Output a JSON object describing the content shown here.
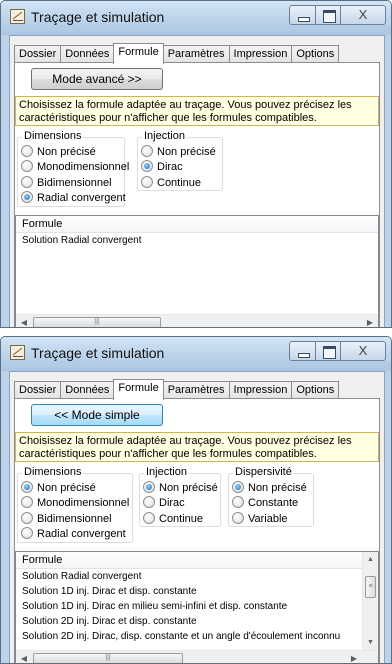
{
  "windows": [
    {
      "title": "Traçage et simulation",
      "tabs": [
        "Dossier",
        "Données",
        "Formule",
        "Paramètres",
        "Impression",
        "Options"
      ],
      "active_tab": 2,
      "mode_button": "Mode avancé >>",
      "info": "Choisissez la formule adaptée au traçage. Vous pouvez précisez les caractéristiques pour n'afficher que les formules compatibles.",
      "dimensions": {
        "label": "Dimensions",
        "options": [
          "Non précisé",
          "Monodimensionnel",
          "Bidimensionnel",
          "Radial convergent"
        ],
        "selected": 3
      },
      "injection": {
        "label": "Injection",
        "options": [
          "Non précisé",
          "Dirac",
          "Continue"
        ],
        "selected": 1
      },
      "formula_list": {
        "header": "Formule",
        "items": [
          "Solution Radial convergent"
        ]
      }
    },
    {
      "title": "Traçage et simulation",
      "tabs": [
        "Dossier",
        "Données",
        "Formule",
        "Paramètres",
        "Impression",
        "Options"
      ],
      "active_tab": 2,
      "mode_button": "<< Mode simple",
      "info": "Choisissez la formule adaptée au traçage. Vous pouvez précisez les caractéristiques pour n'afficher que les formules compatibles.",
      "dimensions": {
        "label": "Dimensions",
        "options": [
          "Non précisé",
          "Monodimensionnel",
          "Bidimensionnel",
          "Radial convergent"
        ],
        "selected": 0
      },
      "injection": {
        "label": "Injection",
        "options": [
          "Non précisé",
          "Dirac",
          "Continue"
        ],
        "selected": 0
      },
      "dispersivity": {
        "label": "Dispersivité",
        "options": [
          "Non précisé",
          "Constante",
          "Variable"
        ],
        "selected": 0
      },
      "formula_list": {
        "header": "Formule",
        "items": [
          "Solution Radial convergent",
          "Solution 1D inj. Dirac et disp. constante",
          "Solution 1D inj. Dirac en milieu semi-infini et disp. constante",
          "Solution 2D inj. Dirac et disp. constante",
          "Solution 2D inj. Dirac, disp. constante et un angle d'écoulement inconnu"
        ]
      }
    }
  ],
  "icons": {
    "app": "tracer-app-icon",
    "minimize": "minimize-icon",
    "maximize": "maximize-icon",
    "close": "close-icon",
    "scroll_left": "arrow-left-icon",
    "scroll_right": "arrow-right-icon",
    "scroll_up": "arrow-up-icon",
    "scroll_down": "arrow-down-icon"
  },
  "glyphs": {
    "close": "X",
    "left": "◀",
    "right": "▶",
    "up": "▲",
    "down": "▼",
    "grip_h": "|||",
    "grip_v": "≡"
  }
}
